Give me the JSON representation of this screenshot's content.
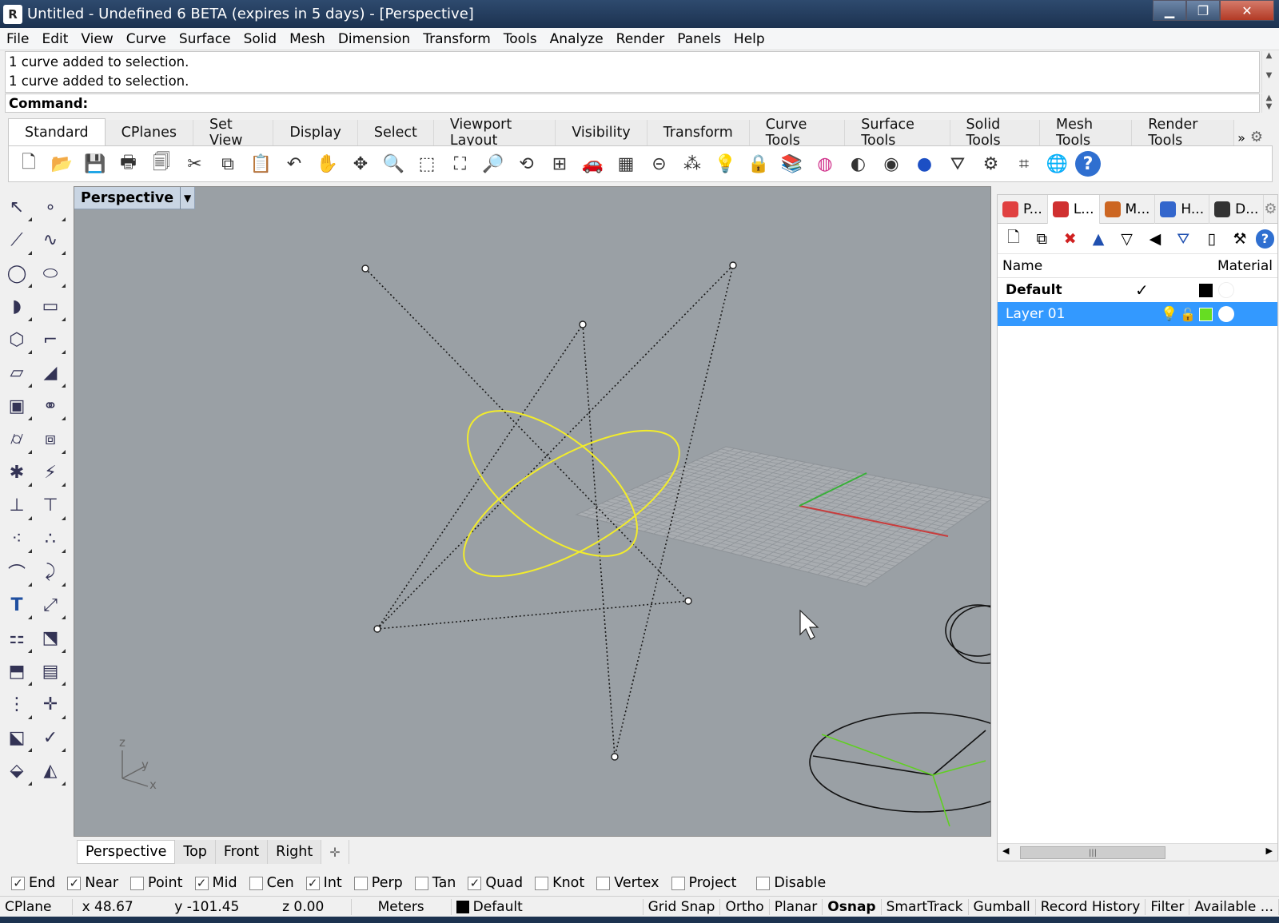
{
  "window": {
    "title": "Untitled - Undefined 6 BETA (expires in 5 days) - [Perspective]",
    "app_icon": "rhino-icon",
    "minimize": "▁",
    "maximize": "❐",
    "close": "✕"
  },
  "menu": [
    "File",
    "Edit",
    "View",
    "Curve",
    "Surface",
    "Solid",
    "Mesh",
    "Dimension",
    "Transform",
    "Tools",
    "Analyze",
    "Render",
    "Panels",
    "Help"
  ],
  "command": {
    "history": [
      "1 curve added to selection.",
      "1 curve added to selection."
    ],
    "label": "Command:",
    "value": ""
  },
  "toolbar_tabs": [
    "Standard",
    "CPlanes",
    "Set View",
    "Display",
    "Select",
    "Viewport Layout",
    "Visibility",
    "Transform",
    "Curve Tools",
    "Surface Tools",
    "Solid Tools",
    "Mesh Tools",
    "Render Tools"
  ],
  "toolbar_tabs_more": "»",
  "toolbar_icons": [
    {
      "name": "new-file-icon",
      "glyph": "🗋"
    },
    {
      "name": "open-folder-icon",
      "glyph": "📂"
    },
    {
      "name": "save-icon",
      "glyph": "💾"
    },
    {
      "name": "print-icon",
      "glyph": "🖶"
    },
    {
      "name": "page-icon",
      "glyph": "🗐"
    },
    {
      "name": "cut-icon",
      "glyph": "✂"
    },
    {
      "name": "copy-icon",
      "glyph": "⧉"
    },
    {
      "name": "paste-icon",
      "glyph": "📋"
    },
    {
      "name": "undo-icon",
      "glyph": "↶"
    },
    {
      "name": "pan-hand-icon",
      "glyph": "✋"
    },
    {
      "name": "rotate-view-icon",
      "glyph": "✥"
    },
    {
      "name": "zoom-icon",
      "glyph": "🔍"
    },
    {
      "name": "zoom-window-icon",
      "glyph": "⬚"
    },
    {
      "name": "zoom-extents-icon",
      "glyph": "⛶"
    },
    {
      "name": "zoom-selected-icon",
      "glyph": "🔎"
    },
    {
      "name": "undo-view-icon",
      "glyph": "⟲"
    },
    {
      "name": "viewport-layout-icon",
      "glyph": "⊞"
    },
    {
      "name": "car-icon",
      "glyph": "🚗"
    },
    {
      "name": "cplane-grid-icon",
      "glyph": "▦"
    },
    {
      "name": "osnap-icon",
      "glyph": "⊝"
    },
    {
      "name": "points-icon",
      "glyph": "⁂"
    },
    {
      "name": "lightbulb-icon",
      "glyph": "💡"
    },
    {
      "name": "lock-icon",
      "glyph": "🔒"
    },
    {
      "name": "layers-icon",
      "glyph": "📚"
    },
    {
      "name": "color-wheel-icon",
      "glyph": "◍"
    },
    {
      "name": "sphere-shaded-icon",
      "glyph": "◐"
    },
    {
      "name": "sphere-rendered-icon",
      "glyph": "◉"
    },
    {
      "name": "sphere-blue-icon",
      "glyph": "●"
    },
    {
      "name": "filter-icon",
      "glyph": "⛛"
    },
    {
      "name": "gear-tools-icon",
      "glyph": "⚙"
    },
    {
      "name": "snap-icon",
      "glyph": "⌗"
    },
    {
      "name": "globe-icon",
      "glyph": "🌐"
    },
    {
      "name": "help-icon",
      "glyph": "?"
    }
  ],
  "left_tools": [
    {
      "name": "select-arrow-icon",
      "glyph": "↖"
    },
    {
      "name": "point-icon",
      "glyph": "∘"
    },
    {
      "name": "polyline-icon",
      "glyph": "⟋"
    },
    {
      "name": "curve-icon",
      "glyph": "∿"
    },
    {
      "name": "circle-icon",
      "glyph": "◯"
    },
    {
      "name": "ellipse-icon",
      "glyph": "⬭"
    },
    {
      "name": "arc-icon",
      "glyph": "◗"
    },
    {
      "name": "rectangle-icon",
      "glyph": "▭"
    },
    {
      "name": "polygon-icon",
      "glyph": "⬡"
    },
    {
      "name": "fillet-icon",
      "glyph": "⌐"
    },
    {
      "name": "surface-icon",
      "glyph": "▱"
    },
    {
      "name": "extrude-surface-icon",
      "glyph": "◢"
    },
    {
      "name": "box-icon",
      "glyph": "▣"
    },
    {
      "name": "boolean-icon",
      "glyph": "⚭"
    },
    {
      "name": "cylinder-icon",
      "glyph": "⌭"
    },
    {
      "name": "mesh-icon",
      "glyph": "⧈"
    },
    {
      "name": "puzzle-icon",
      "glyph": "✱"
    },
    {
      "name": "light-icon",
      "glyph": "⚡"
    },
    {
      "name": "trim-icon",
      "glyph": "⊥"
    },
    {
      "name": "split-icon",
      "glyph": "⊤"
    },
    {
      "name": "group-icon",
      "glyph": "⁖"
    },
    {
      "name": "ungroup-icon",
      "glyph": "∴"
    },
    {
      "name": "offset-icon",
      "glyph": "⌒"
    },
    {
      "name": "blend-icon",
      "glyph": "⤸"
    },
    {
      "name": "text-icon",
      "glyph": "T"
    },
    {
      "name": "dimension-icon",
      "glyph": "⤢"
    },
    {
      "name": "array-icon",
      "glyph": "⚏"
    },
    {
      "name": "scale-icon",
      "glyph": "⬔"
    },
    {
      "name": "block-icon",
      "glyph": "⬒"
    },
    {
      "name": "hatch-icon",
      "glyph": "▤"
    },
    {
      "name": "grid-array-icon",
      "glyph": "⋮"
    },
    {
      "name": "gumball-icon",
      "glyph": "✛"
    },
    {
      "name": "analyze-icon",
      "glyph": "⬕"
    },
    {
      "name": "check-icon",
      "glyph": "✓"
    },
    {
      "name": "render-shapes-icon",
      "glyph": "⬙"
    },
    {
      "name": "material-icon",
      "glyph": "◭"
    }
  ],
  "viewport": {
    "title": "Perspective",
    "axis": {
      "z": "z",
      "y": "y",
      "x": "x"
    },
    "tabs": [
      "Perspective",
      "Top",
      "Front",
      "Right"
    ],
    "add_tab": "✛",
    "colors": {
      "background": "#9aa0a5",
      "curve": "#f2ec2c",
      "x_axis": "#c83c3c",
      "y_axis": "#38b038",
      "control_polygon": "#1a1a1a"
    }
  },
  "panel": {
    "tabs": [
      {
        "label": "P...",
        "icon": "properties-icon",
        "color": "#e04040"
      },
      {
        "label": "L...",
        "icon": "layers-icon",
        "color": "#d03030"
      },
      {
        "label": "M...",
        "icon": "materials-icon",
        "color": "#cc6622"
      },
      {
        "label": "H...",
        "icon": "help-panel-icon",
        "color": "#3366cc"
      },
      {
        "label": "D...",
        "icon": "display-icon",
        "color": "#333333"
      }
    ],
    "settings_icon": "gear-icon",
    "layer_tools": [
      {
        "name": "new-layer-icon",
        "glyph": "🗋"
      },
      {
        "name": "new-sublayer-icon",
        "glyph": "⧉"
      },
      {
        "name": "delete-layer-icon",
        "glyph": "✖"
      },
      {
        "name": "move-up-icon",
        "glyph": "▲"
      },
      {
        "name": "move-down-icon",
        "glyph": "▽"
      },
      {
        "name": "move-left-icon",
        "glyph": "◀"
      },
      {
        "name": "filter-layers-icon",
        "glyph": "⛛"
      },
      {
        "name": "layer-states-icon",
        "glyph": "▯"
      },
      {
        "name": "layer-tools-icon",
        "glyph": "⚒"
      },
      {
        "name": "layer-help-icon",
        "glyph": "?"
      }
    ],
    "columns": {
      "name": "Name",
      "material": "Material"
    },
    "layers": [
      {
        "name": "Default",
        "current": "✓",
        "color": "#000000"
      },
      {
        "name": "Layer 01",
        "current": "",
        "color": "#66dd22"
      }
    ],
    "scroll_thumb": "|||"
  },
  "osnaps": [
    {
      "label": "End",
      "checked": true
    },
    {
      "label": "Near",
      "checked": true
    },
    {
      "label": "Point",
      "checked": false
    },
    {
      "label": "Mid",
      "checked": true
    },
    {
      "label": "Cen",
      "checked": false
    },
    {
      "label": "Int",
      "checked": true
    },
    {
      "label": "Perp",
      "checked": false
    },
    {
      "label": "Tan",
      "checked": false
    },
    {
      "label": "Quad",
      "checked": true
    },
    {
      "label": "Knot",
      "checked": false
    },
    {
      "label": "Vertex",
      "checked": false
    },
    {
      "label": "Project",
      "checked": false
    },
    {
      "label": "Disable",
      "checked": false
    }
  ],
  "status": {
    "cplane": "CPlane",
    "x": "x 48.67",
    "y": "y -101.45",
    "z": "z 0.00",
    "units": "Meters",
    "layer": "Default",
    "toggles": [
      "Grid Snap",
      "Ortho",
      "Planar",
      "Osnap",
      "SmartTrack",
      "Gumball",
      "Record History",
      "Filter",
      "Available ..."
    ],
    "active_toggle": "Osnap"
  }
}
